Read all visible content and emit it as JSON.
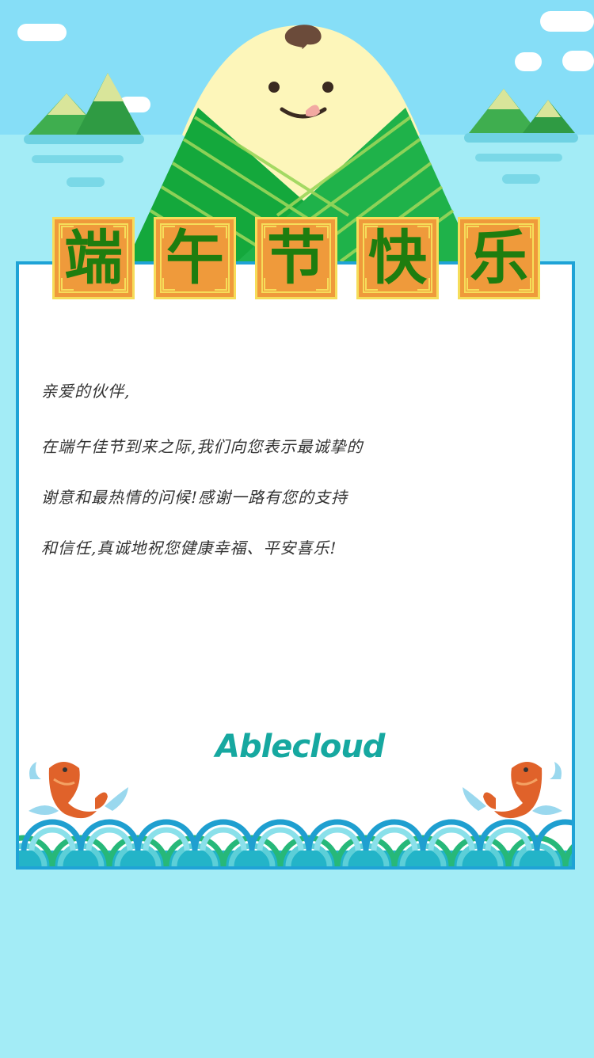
{
  "title": {
    "chars": [
      "端",
      "午",
      "节",
      "快",
      "乐"
    ]
  },
  "letter": {
    "greeting": "亲爱的伙伴,",
    "line1": "在端午佳节到来之际,我们向您表示最诚挚的",
    "line2": "谢意和最热情的问候!感谢一路有您的支持",
    "line3": "和信任,真诚地祝您健康幸福、平安喜乐!"
  },
  "brand": {
    "logo": "Ablecloud"
  },
  "colors": {
    "sky": "#86def7",
    "sea": "#a3ecf6",
    "card_border": "#1fa3d6",
    "tile_bg": "#ef9a3b",
    "tile_border": "#f6dd5a",
    "title_text": "#1e7d0f",
    "zongzi_green": "#14a83c",
    "logo": "#16a8a0"
  },
  "icons": [
    "zongzi-mascot",
    "mountain-island-left",
    "mountain-island-right",
    "koi-fish-left",
    "koi-fish-right",
    "wave-pattern"
  ]
}
